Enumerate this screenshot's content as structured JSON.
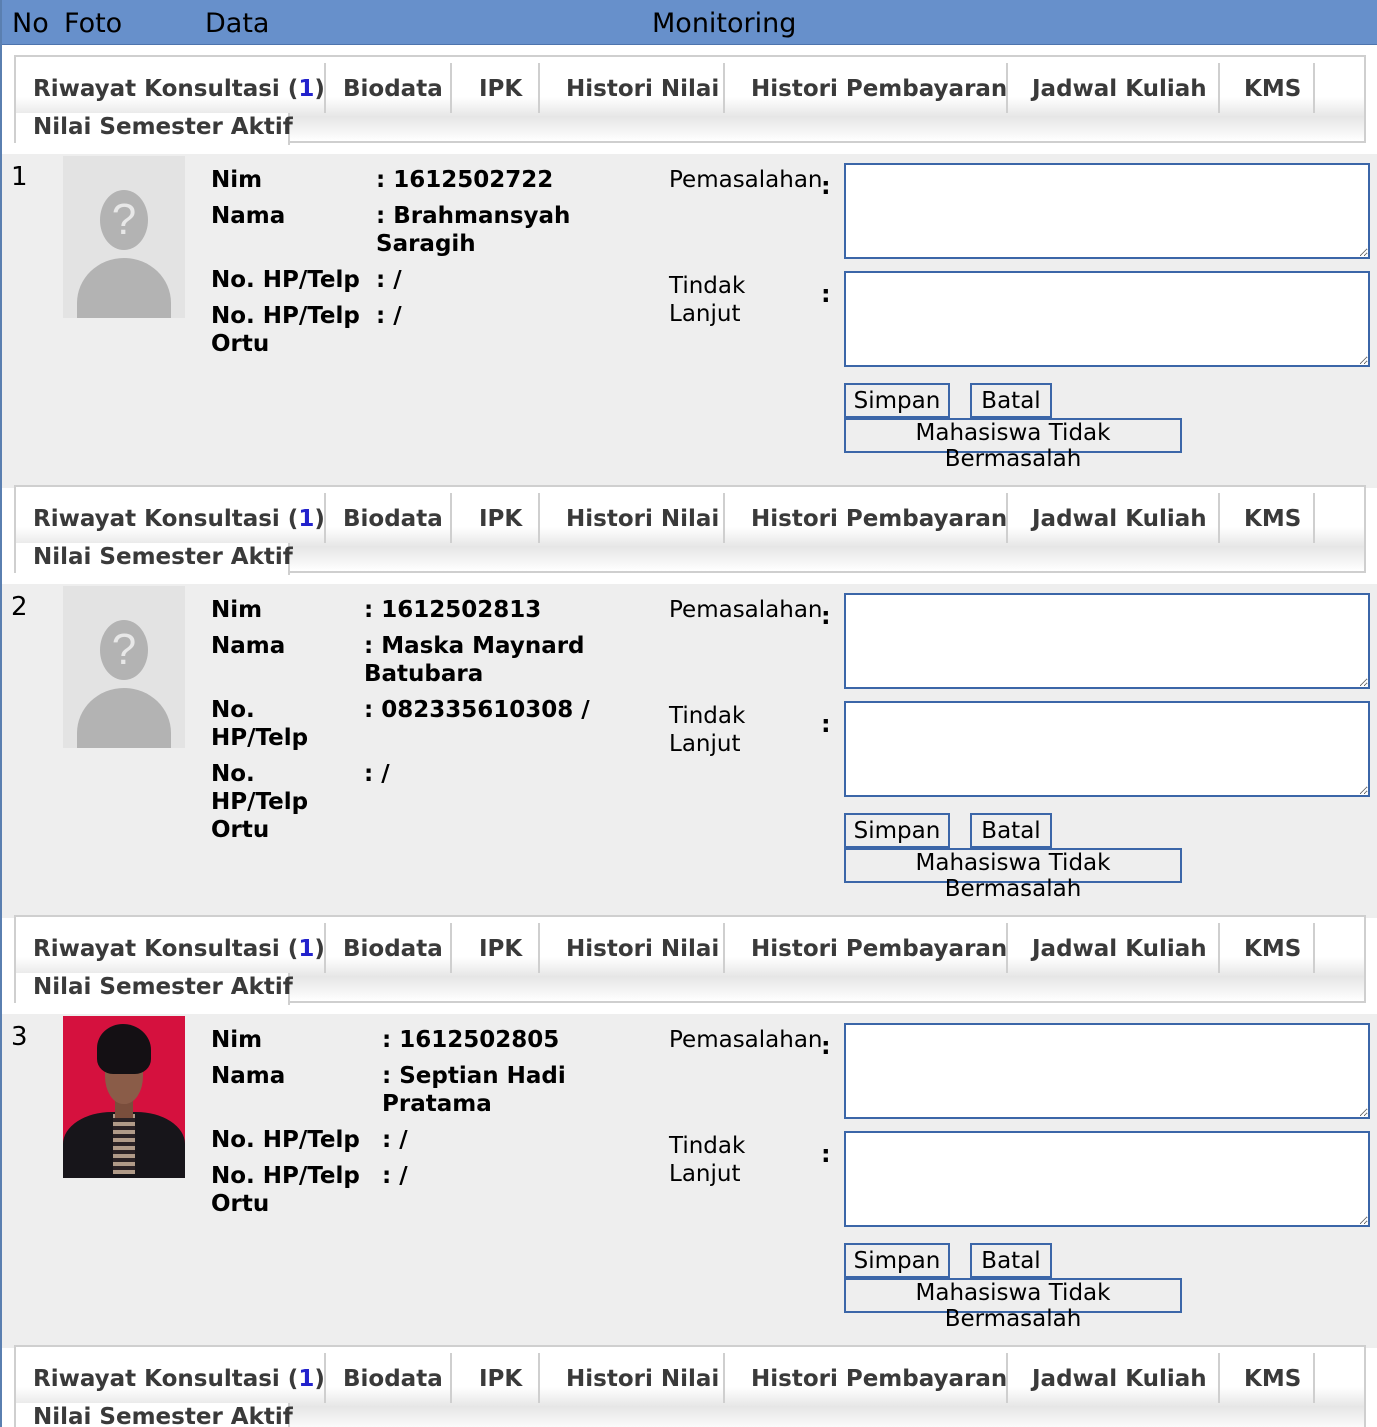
{
  "header": {
    "no": "No",
    "foto": "Foto",
    "data": "Data",
    "monitoring": "Monitoring"
  },
  "tabs": {
    "riwayat_prefix": "Riwayat Konsultasi (",
    "riwayat_count": "1",
    "riwayat_suffix": ")",
    "biodata": "Biodata",
    "ipk": "IPK",
    "histori_nilai": "Histori Nilai",
    "histori_pembayaran": "Histori Pembayaran",
    "jadwal_kuliah": "Jadwal Kuliah",
    "kms": "KMS",
    "nilai_semester_aktif": "Nilai Semester Aktif"
  },
  "form": {
    "pemasalahan_label": "Pemasalahan",
    "tindak_lanjut_label": "Tindak Lanjut",
    "colon": ":",
    "simpan": "Simpan",
    "batal": "Batal",
    "tidak_bermasalah": "Mahasiswa Tidak Bermasalah"
  },
  "labels": {
    "nim": "Nim",
    "nama": "Nama",
    "hp": "No. HP/Telp",
    "hp_ortu": "No. HP/Telp Ortu"
  },
  "students": [
    {
      "no": "1",
      "photo": "placeholder-icon",
      "nim": ": 1612502722",
      "nama": ": Brahmansyah Saragih",
      "hp": ": /",
      "hp_ortu": ": /"
    },
    {
      "no": "2",
      "photo": "placeholder-icon",
      "nim": ": 1612502813",
      "nama": ": Maska Maynard Batubara",
      "hp": ": 082335610308 /",
      "hp_ortu": ": /"
    },
    {
      "no": "3",
      "photo": "student-photo",
      "nim": ": 1612502805",
      "nama": ": Septian Hadi Pratama",
      "hp": ": /",
      "hp_ortu": ": /"
    }
  ]
}
